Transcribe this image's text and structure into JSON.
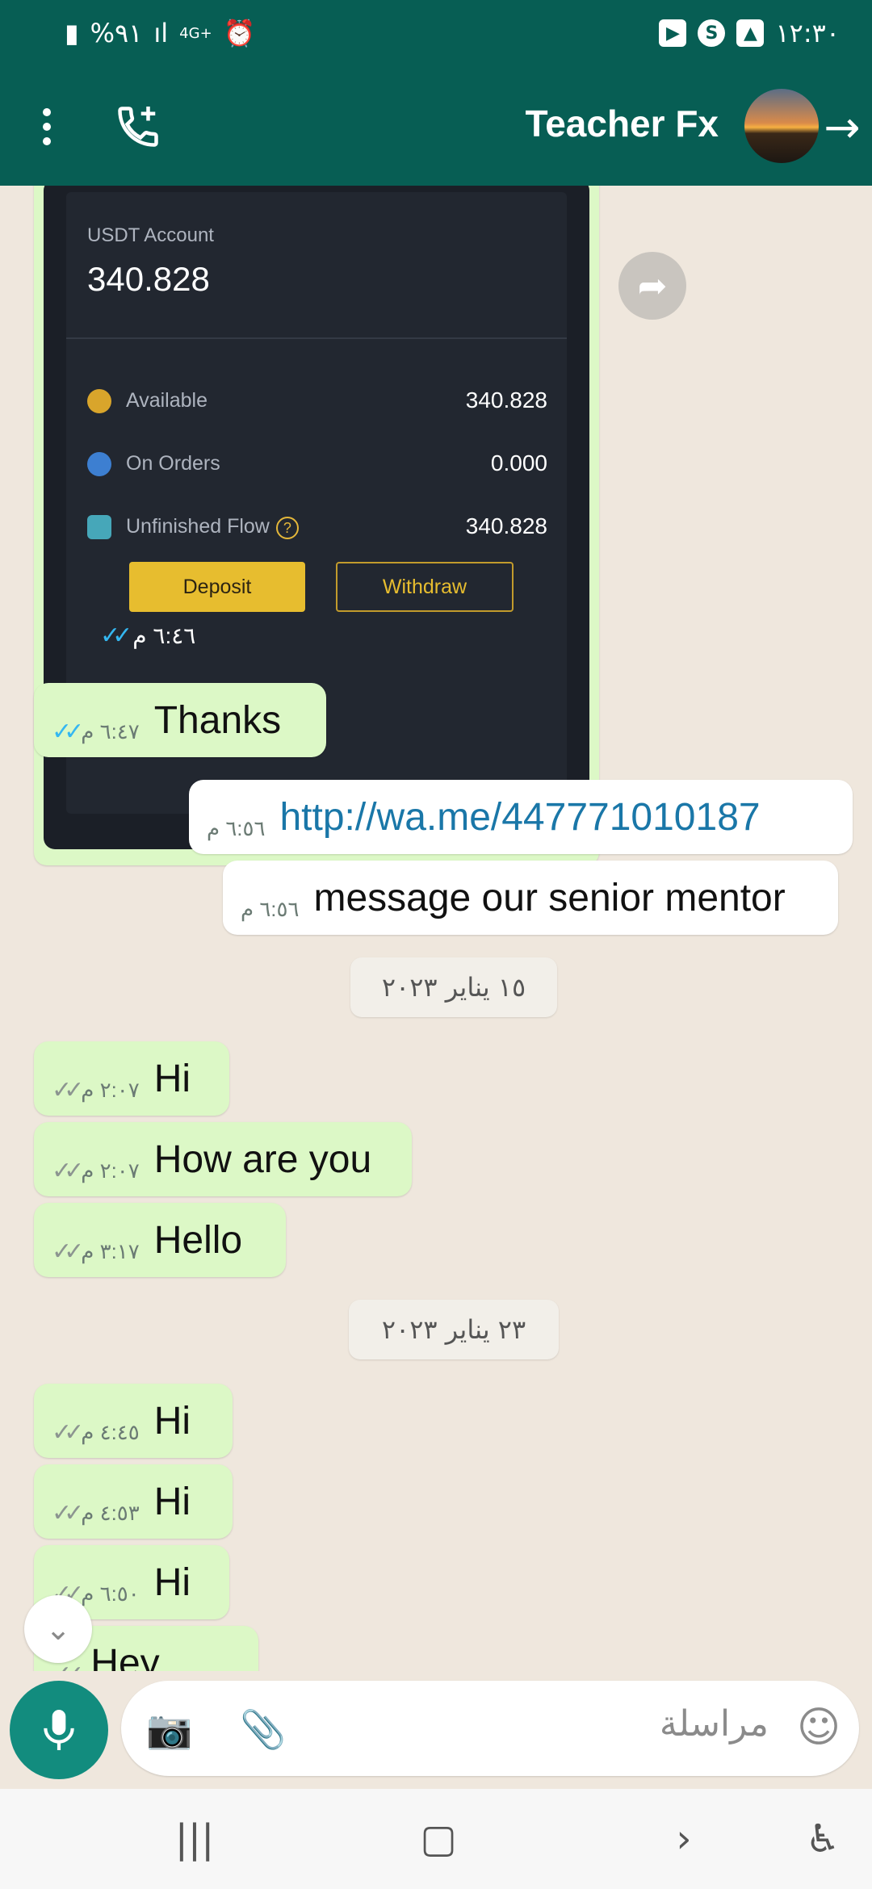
{
  "status_bar": {
    "battery": "%٩١",
    "network": "4G+",
    "time": "١٢:٣٠"
  },
  "header": {
    "title": "Teacher Fx"
  },
  "screenshot_card": {
    "account_label": "USDT Account",
    "account_value": "340.828",
    "rows": [
      {
        "label": "Available",
        "value": "340.828"
      },
      {
        "label": "On Orders",
        "value": "0.000"
      },
      {
        "label": "Unfinished Flow",
        "value": "340.828"
      }
    ],
    "deposit_label": "Deposit",
    "withdraw_label": "Withdraw",
    "time": "٦:٤٦ م"
  },
  "messages": [
    {
      "text": "Thanks",
      "time": "٦:٤٧ م"
    },
    {
      "text": "http://wa.me/447771010187",
      "time": "٦:٥٦ م"
    },
    {
      "text": "message our senior mentor",
      "time": "٦:٥٦ م"
    },
    {
      "text": "Hi",
      "time": "٢:٠٧ م"
    },
    {
      "text": "How are you",
      "time": "٢:٠٧ م"
    },
    {
      "text": "Hello",
      "time": "٣:١٧ م"
    },
    {
      "text": "Hi",
      "time": "٤:٤٥ م"
    },
    {
      "text": "Hi",
      "time": "٤:٥٣ م"
    },
    {
      "text": "Hi",
      "time": "٦:٥٠ م"
    },
    {
      "text": "Hey",
      "time": ""
    }
  ],
  "dates": [
    "١٥ يناير ٢٠٢٣",
    "٢٣ يناير ٢٠٢٣"
  ],
  "composer": {
    "placeholder": "مراسلة"
  },
  "icons": {
    "status_icons": [
      "battery-icon",
      "signal-icon",
      "alarm-icon",
      "play-icon",
      "shazam-icon",
      "gallery-icon"
    ],
    "header_icons": [
      "more-options-icon",
      "add-call-icon",
      "back-arrow-icon"
    ],
    "composer_icons": [
      "mic-icon",
      "camera-icon",
      "attach-icon",
      "emoji-icon"
    ],
    "nav_icons": [
      "recents-icon",
      "home-icon",
      "back-icon",
      "accessibility-icon"
    ]
  },
  "colors": {
    "header": "#075e54",
    "outgoing_bubble": "#dcf8c6",
    "incoming_bubble": "#ffffff",
    "chat_background": "#efe7dd",
    "mic_button": "#128c7e",
    "link": "#1a77a8",
    "read_ticks": "#34b7f1"
  }
}
